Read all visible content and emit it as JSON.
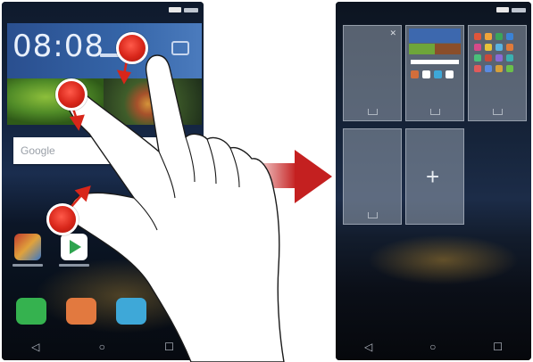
{
  "left_screen": {
    "clock": {
      "time": "08:08"
    },
    "search": {
      "label": "Google"
    },
    "nav": {
      "back": "◁",
      "home": "○",
      "recent": "☐"
    }
  },
  "right_screen": {
    "add_page": "+",
    "nav": {
      "back": "◁",
      "home": "○",
      "recent": "☐"
    }
  },
  "colors": {
    "arrow": "#c42020",
    "touch_marker": "#d8261a",
    "clock_widget": "#3565a8"
  },
  "icons": {
    "gesture": "pinch-in-gesture",
    "transition": "right-arrow"
  }
}
